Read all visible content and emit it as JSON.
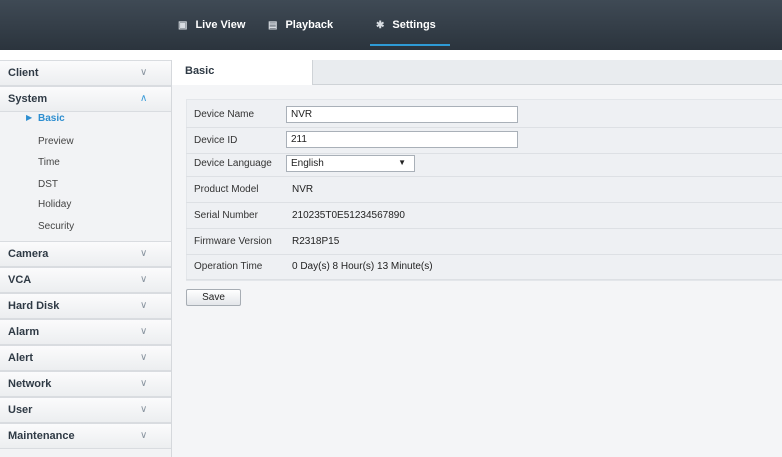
{
  "topnav": {
    "tabs": [
      {
        "label": "Live View",
        "icon": "monitor-icon"
      },
      {
        "label": "Playback",
        "icon": "film-icon"
      },
      {
        "label": "Settings",
        "icon": "gear-icon",
        "active": true
      }
    ],
    "accent_color": "#2e9bd6"
  },
  "sidebar": {
    "sections": [
      {
        "label": "Client",
        "expanded": false
      },
      {
        "label": "System",
        "expanded": true,
        "items": [
          "Basic",
          "Preview",
          "Time",
          "DST",
          "Holiday",
          "Security"
        ],
        "active_item": "Basic"
      },
      {
        "label": "Camera",
        "expanded": false
      },
      {
        "label": "VCA",
        "expanded": false
      },
      {
        "label": "Hard Disk",
        "expanded": false
      },
      {
        "label": "Alarm",
        "expanded": false
      },
      {
        "label": "Alert",
        "expanded": false
      },
      {
        "label": "Network",
        "expanded": false
      },
      {
        "label": "User",
        "expanded": false
      },
      {
        "label": "Maintenance",
        "expanded": false
      }
    ]
  },
  "page": {
    "tab_label": "Basic",
    "fields": [
      {
        "label": "Device Name",
        "value": "NVR",
        "type": "input"
      },
      {
        "label": "Device ID",
        "value": "211",
        "type": "input"
      },
      {
        "label": "Device Language",
        "value": "English",
        "type": "select"
      },
      {
        "label": "Product Model",
        "value": "NVR",
        "type": "text"
      },
      {
        "label": "Serial Number",
        "value": "210235T0E51234567890",
        "type": "text"
      },
      {
        "label": "Firmware Version",
        "value": "R2318P15",
        "type": "text"
      },
      {
        "label": "Operation Time",
        "value": "0 Day(s)  8 Hour(s)  13 Minute(s)",
        "type": "text"
      }
    ],
    "save_label": "Save"
  }
}
